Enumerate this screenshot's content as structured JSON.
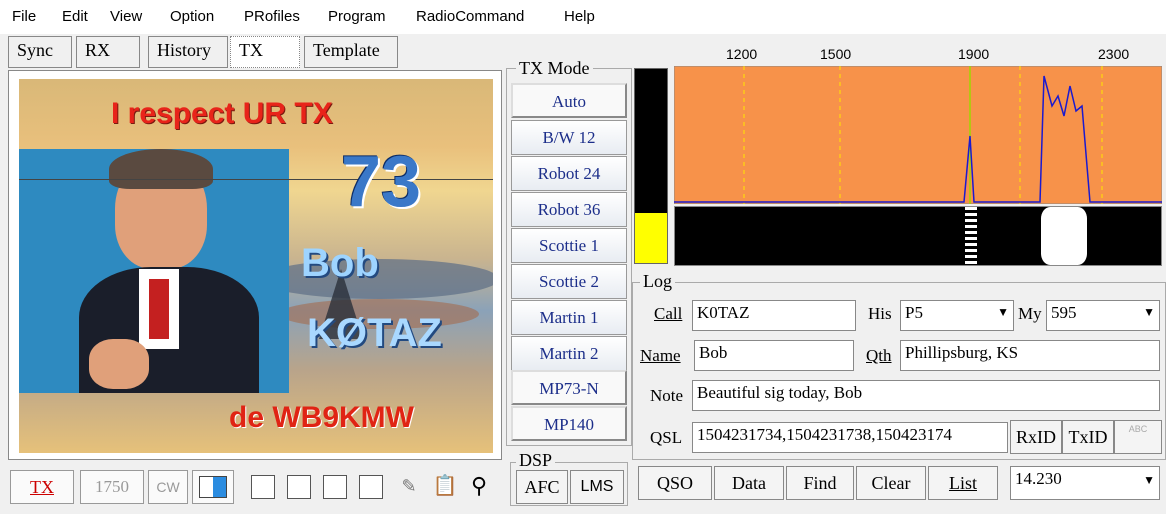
{
  "menu": [
    "File",
    "Edit",
    "View",
    "Option",
    "PRofiles",
    "Program",
    "RadioCommand",
    "Help"
  ],
  "tabs": [
    "Sync",
    "RX",
    "History",
    "TX",
    "Template"
  ],
  "image": {
    "headline": "I respect UR TX",
    "number": "73",
    "name": "Bob",
    "call": "KØTAZ",
    "signoff": "de WB9KMW"
  },
  "tx_mode": {
    "title": "TX Mode",
    "modes": [
      "Auto",
      "B/W 12",
      "Robot 24",
      "Robot 36",
      "Scottie 1",
      "Scottie 2",
      "Martin 1",
      "Martin 2",
      "MP73-N",
      "MP140"
    ]
  },
  "dsp": {
    "title": "DSP",
    "afc": "AFC",
    "lms": "LMS"
  },
  "toolbar": {
    "tx": "TX",
    "freq": "1750",
    "cw": "CW"
  },
  "spectrum": {
    "ticks": [
      "1200",
      "1500",
      "1900",
      "2300"
    ]
  },
  "log": {
    "title": "Log",
    "call_label": "Call",
    "call_value": "K0TAZ",
    "his_label": "His",
    "his_value": "P5",
    "my_label": "My",
    "my_value": "595",
    "name_label": "Name",
    "name_value": "Bob",
    "qth_label": "Qth",
    "qth_value": "Phillipsburg, KS",
    "note_label": "Note",
    "note_value": "Beautiful sig today, Bob",
    "qsl_label": "QSL",
    "qsl_value": "1504231734,1504231738,150423174",
    "rxid": "RxID",
    "txid": "TxID",
    "abc": "ABC"
  },
  "bottom": {
    "qso": "QSO",
    "data": "Data",
    "find": "Find",
    "clear": "Clear",
    "list": "List",
    "freq": "14.230"
  },
  "colors": {
    "spectrum_bg": "#f7924a",
    "waterfall": "#000000",
    "level": "#ffff00",
    "mode_text": "#1c2e8a"
  }
}
